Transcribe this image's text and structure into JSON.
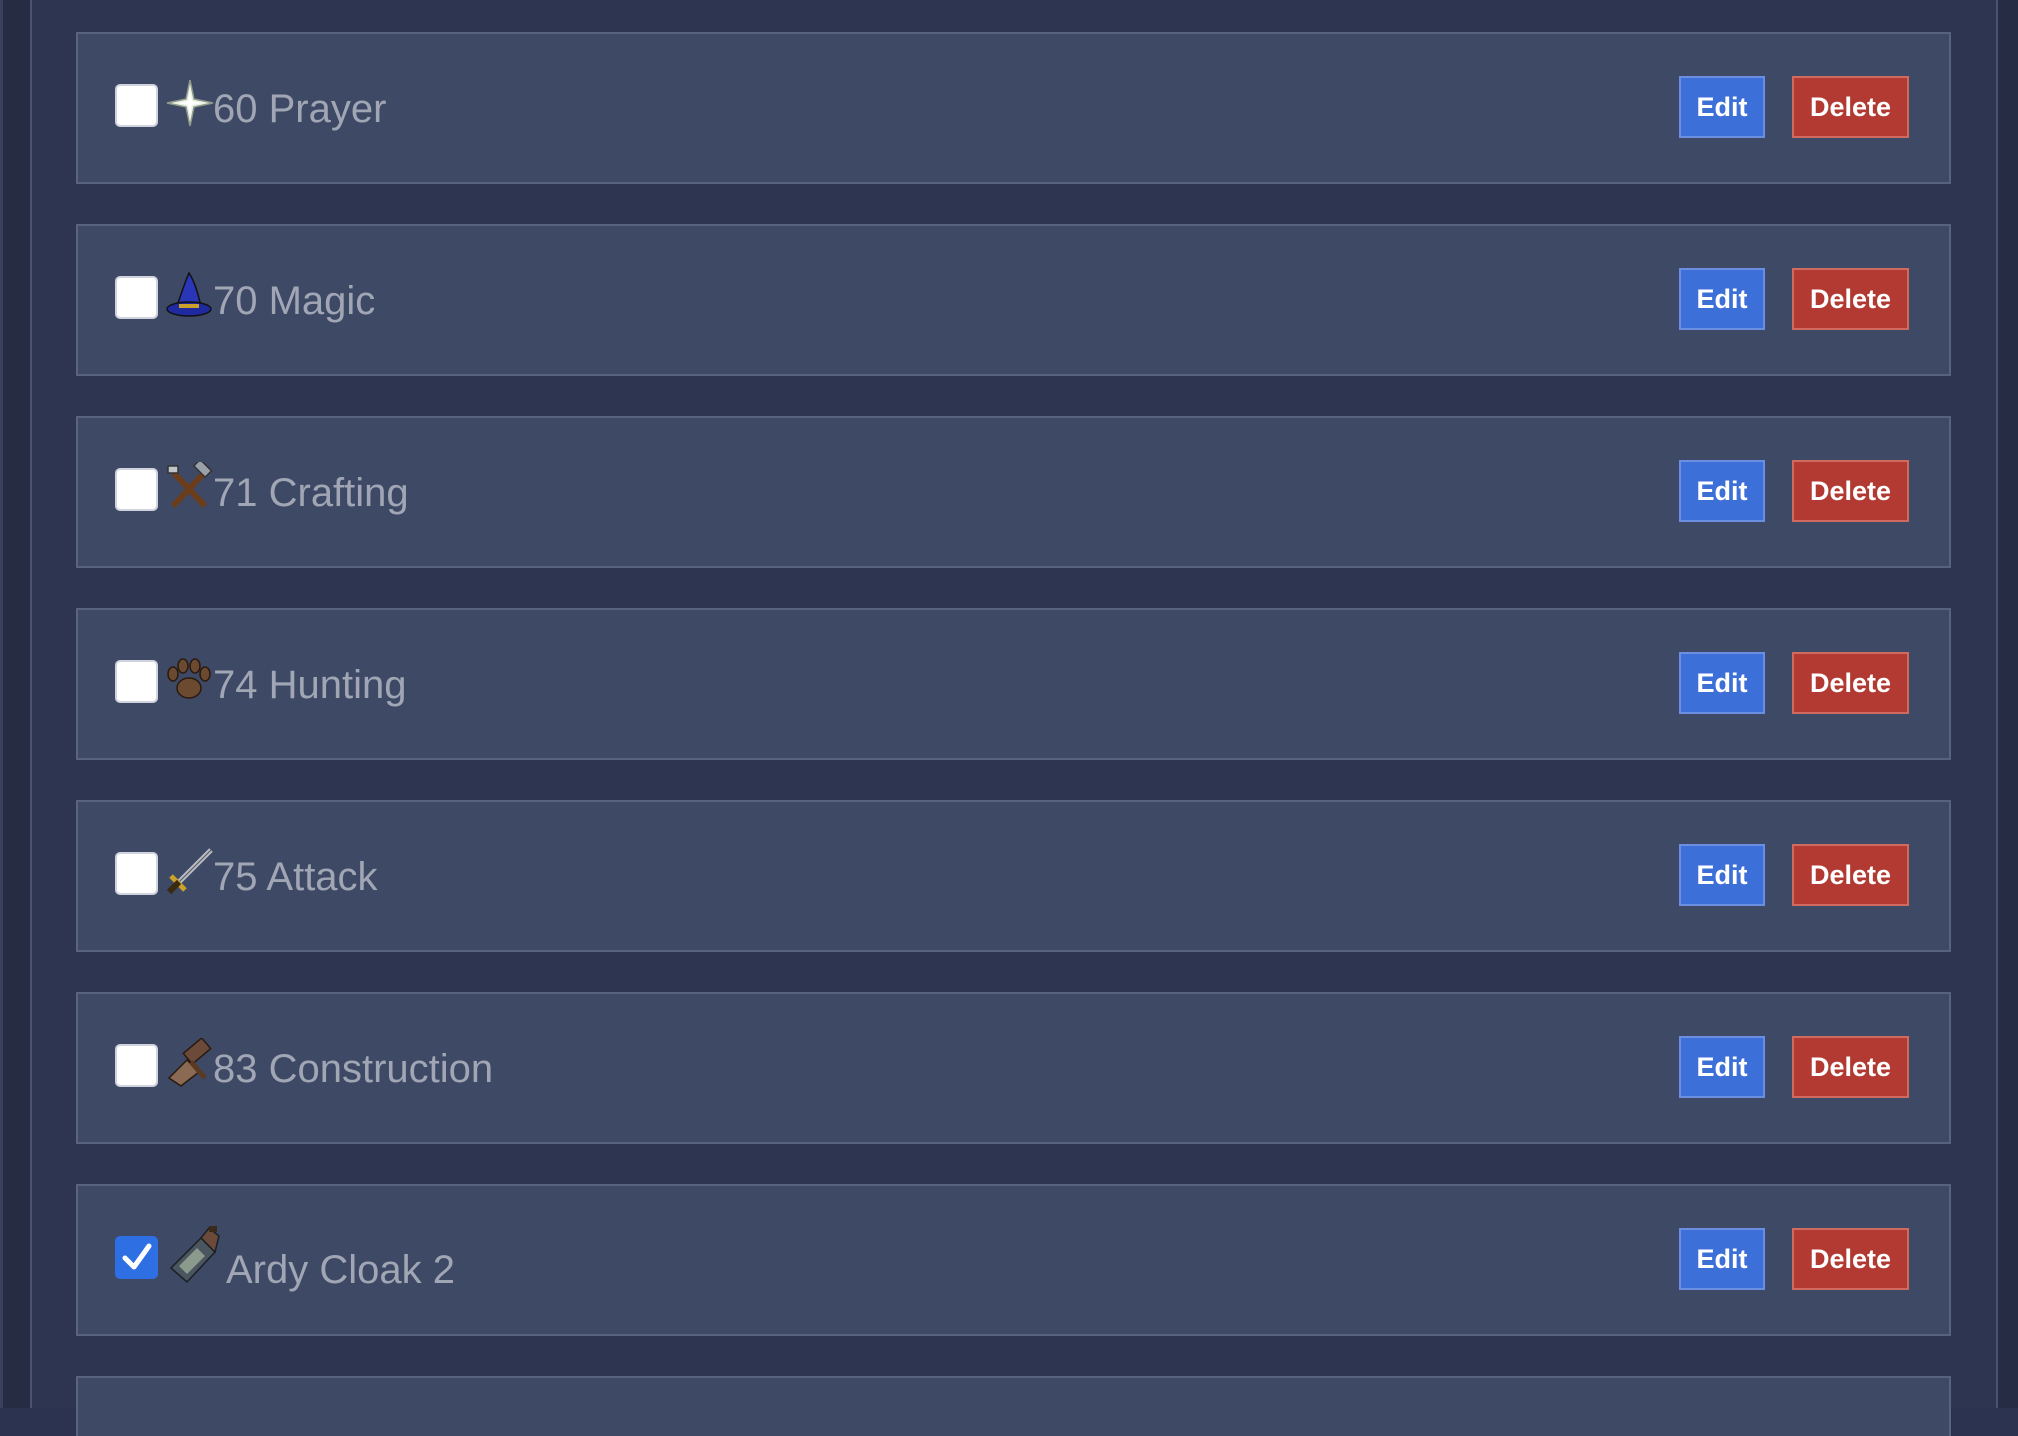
{
  "items": [
    {
      "label": "60 Prayer",
      "checked": false,
      "icon": "prayer-star-icon",
      "edit_label": "Edit",
      "delete_label": "Delete"
    },
    {
      "label": "70 Magic",
      "checked": false,
      "icon": "wizard-hat-icon",
      "edit_label": "Edit",
      "delete_label": "Delete"
    },
    {
      "label": "71 Crafting",
      "checked": false,
      "icon": "hammer-chisel-icon",
      "edit_label": "Edit",
      "delete_label": "Delete"
    },
    {
      "label": "74 Hunting",
      "checked": false,
      "icon": "paw-print-icon",
      "edit_label": "Edit",
      "delete_label": "Delete"
    },
    {
      "label": "75 Attack",
      "checked": false,
      "icon": "sword-icon",
      "edit_label": "Edit",
      "delete_label": "Delete"
    },
    {
      "label": "83 Construction",
      "checked": false,
      "icon": "saw-hammer-icon",
      "edit_label": "Edit",
      "delete_label": "Delete"
    },
    {
      "label": "Ardy Cloak 2",
      "checked": true,
      "icon": "cloak-icon",
      "edit_label": "Edit",
      "delete_label": "Delete"
    }
  ],
  "colors": {
    "background": "#2d3550",
    "row": "#3e4966",
    "edit": "#3d6fd8",
    "delete": "#b23a33",
    "label": "#a1a6b4",
    "checked": "#2f6fe4"
  }
}
